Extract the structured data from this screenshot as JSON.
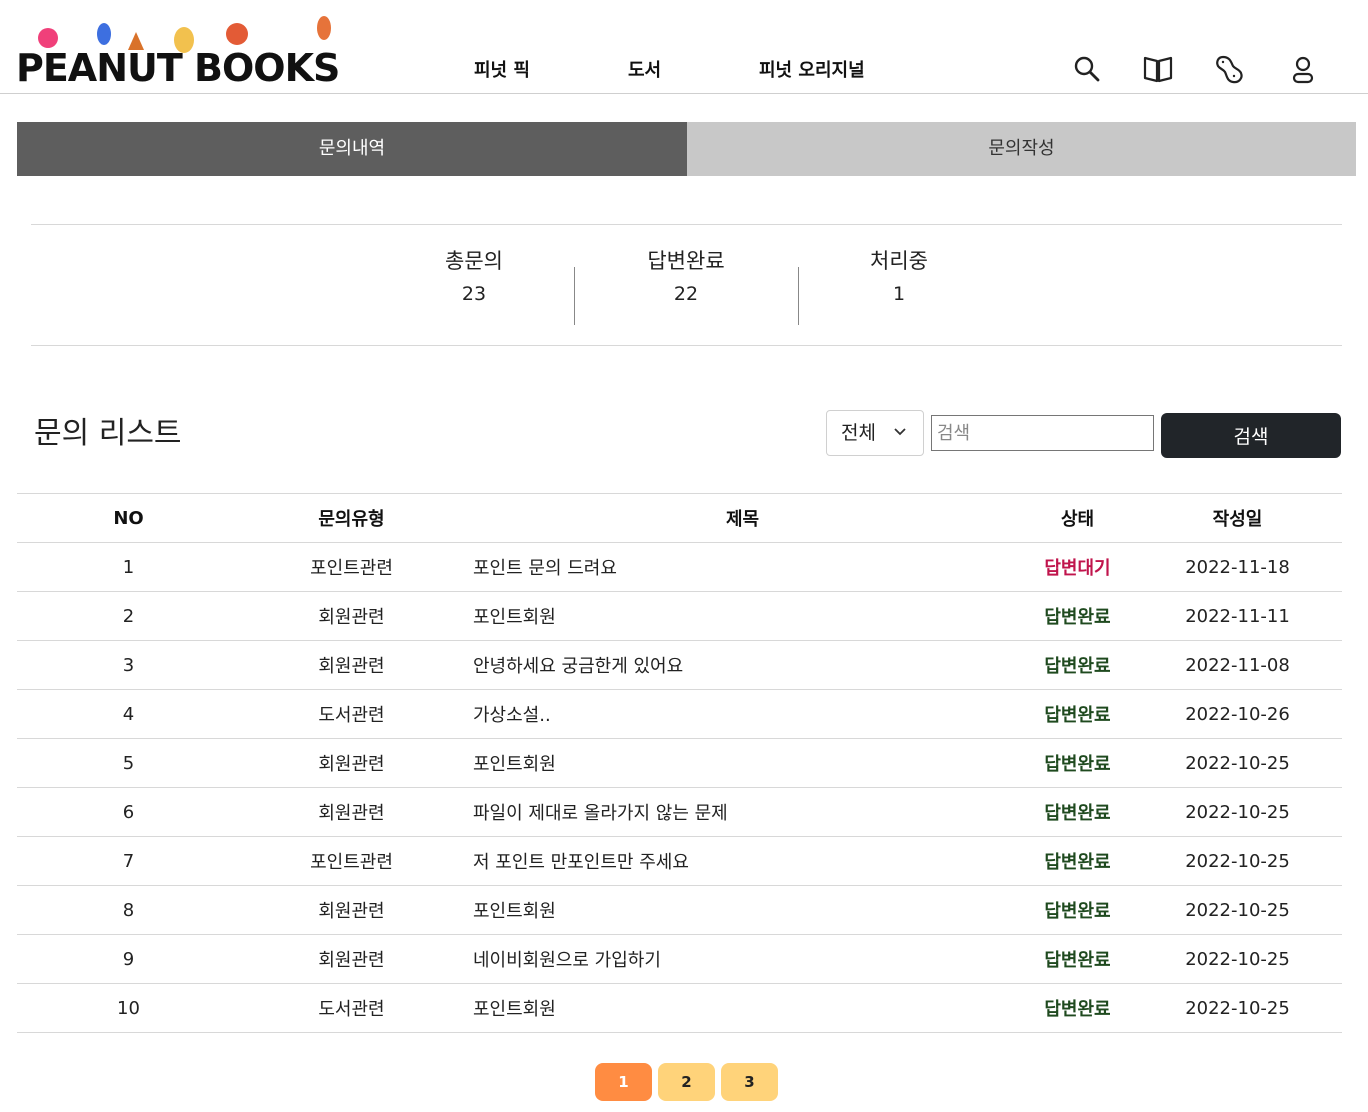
{
  "header": {
    "logo_text": "PEANUT BOOKS",
    "nav": [
      "피넛 픽",
      "도서",
      "피넛 오리지널"
    ],
    "icons": [
      "search-icon",
      "book-icon",
      "peanut-icon",
      "user-icon"
    ]
  },
  "tabs": {
    "active": "문의내역",
    "inactive": "문의작성"
  },
  "stats": [
    {
      "label": "총문의",
      "value": "23"
    },
    {
      "label": "답변완료",
      "value": "22"
    },
    {
      "label": "처리중",
      "value": "1"
    }
  ],
  "list": {
    "title": "문의 리스트",
    "filter_selected": "전체",
    "search_placeholder": "검색",
    "search_button": "검색"
  },
  "table": {
    "headers": [
      "NO",
      "문의유형",
      "제목",
      "상태",
      "작성일"
    ],
    "rows": [
      {
        "no": "1",
        "type": "포인트관련",
        "title": "포인트 문의 드려요",
        "status": "답변대기",
        "date": "2022-11-18"
      },
      {
        "no": "2",
        "type": "회원관련",
        "title": "포인트회원",
        "status": "답변완료",
        "date": "2022-11-11"
      },
      {
        "no": "3",
        "type": "회원관련",
        "title": "안녕하세요 궁금한게 있어요",
        "status": "답변완료",
        "date": "2022-11-08"
      },
      {
        "no": "4",
        "type": "도서관련",
        "title": "가상소설..",
        "status": "답변완료",
        "date": "2022-10-26"
      },
      {
        "no": "5",
        "type": "회원관련",
        "title": "포인트회원",
        "status": "답변완료",
        "date": "2022-10-25"
      },
      {
        "no": "6",
        "type": "회원관련",
        "title": "파일이 제대로 올라가지 않는 문제",
        "status": "답변완료",
        "date": "2022-10-25"
      },
      {
        "no": "7",
        "type": "포인트관련",
        "title": "저 포인트 만포인트만 주세요",
        "status": "답변완료",
        "date": "2022-10-25"
      },
      {
        "no": "8",
        "type": "회원관련",
        "title": "포인트회원",
        "status": "답변완료",
        "date": "2022-10-25"
      },
      {
        "no": "9",
        "type": "회원관련",
        "title": "네이비회원으로 가입하기",
        "status": "답변완료",
        "date": "2022-10-25"
      },
      {
        "no": "10",
        "type": "도서관련",
        "title": "포인트회원",
        "status": "답변완료",
        "date": "2022-10-25"
      }
    ]
  },
  "status_colors": {
    "답변대기": "#c0144c",
    "답변완료": "#1f4a1f"
  },
  "pagination": {
    "pages": [
      "1",
      "2",
      "3"
    ],
    "current": "1",
    "active_color": "#ff8c42",
    "inactive_color": "#ffd37a"
  }
}
